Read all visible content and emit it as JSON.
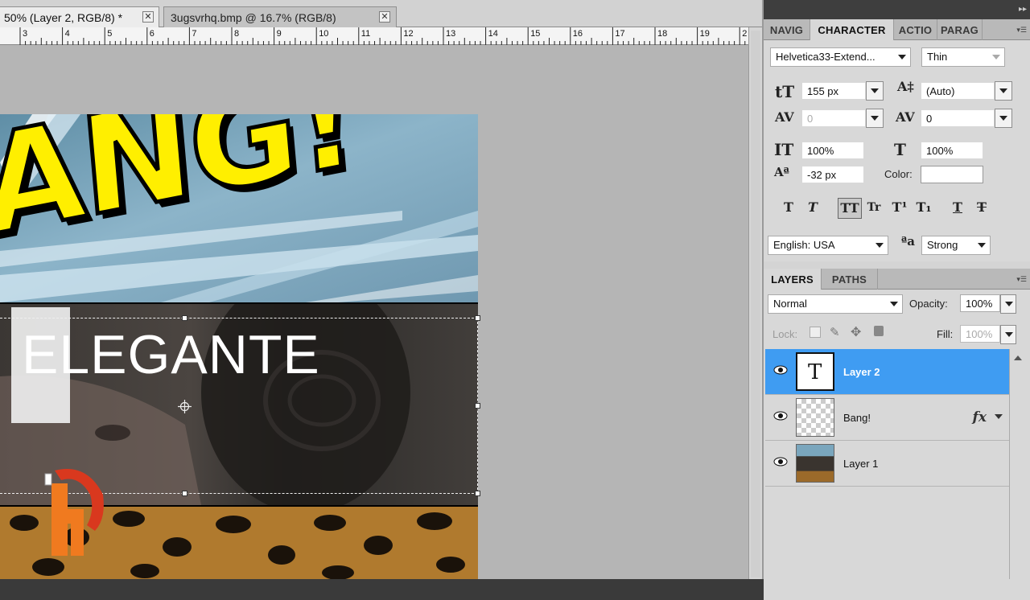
{
  "document_tabs": [
    {
      "label": "50% (Layer 2, RGB/8) *",
      "active": true
    },
    {
      "label": "3ugsvrhq.bmp @ 16.7% (RGB/8)",
      "active": false
    }
  ],
  "ruler": {
    "numbers": [
      "3",
      "4",
      "5",
      "6",
      "7",
      "8",
      "9",
      "10",
      "11",
      "12",
      "13",
      "14",
      "15",
      "16",
      "17",
      "18",
      "19",
      "2"
    ]
  },
  "canvas": {
    "bang_text": "ANG!",
    "elegante_text": "ELEGANTE"
  },
  "panel_tabs": [
    "NAVIG",
    "CHARACTER",
    "ACTIO",
    "PARAG"
  ],
  "character": {
    "font_family": "Helvetica33-Extend...",
    "font_style": "Thin",
    "font_size": "155 px",
    "leading": "(Auto)",
    "kerning": "0",
    "tracking": "0",
    "vertical_scale": "100%",
    "horizontal_scale": "100%",
    "baseline_shift": "-32 px",
    "color_label": "Color:",
    "language": "English: USA",
    "antialias": "Strong",
    "style_buttons": [
      "T",
      "T",
      "TT",
      "Tr",
      "T¹",
      "T₁",
      "T",
      "T"
    ]
  },
  "layers_panel": {
    "tabs": [
      "LAYERS",
      "PATHS"
    ],
    "blend_mode": "Normal",
    "opacity_label": "Opacity:",
    "opacity_value": "100%",
    "lock_label": "Lock:",
    "fill_label": "Fill:",
    "fill_value": "100%",
    "layers": [
      {
        "name": "Layer 2",
        "type": "text",
        "selected": true,
        "fx": false
      },
      {
        "name": "Bang!",
        "type": "transparent",
        "selected": false,
        "fx": true
      },
      {
        "name": "Layer 1",
        "type": "image",
        "selected": false,
        "fx": false
      }
    ],
    "thumb_text_glyph": "T",
    "fx_label": "fx"
  },
  "colors": {
    "selection": "#3f9cf2",
    "bang_yellow": "#ffef00",
    "panel_bg": "#d8d8d8"
  }
}
